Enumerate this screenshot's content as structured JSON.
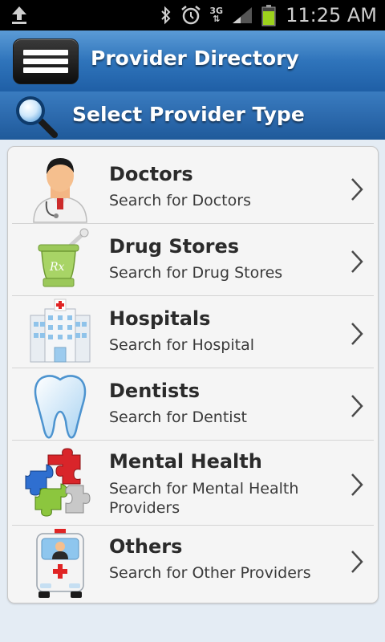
{
  "status_bar": {
    "time": "11:25 AM",
    "network": "3G",
    "icons": [
      "upload-icon",
      "bluetooth-icon",
      "alarm-icon",
      "network-3g-icon",
      "signal-icon",
      "battery-icon"
    ]
  },
  "header": {
    "title": "Provider Directory",
    "menu_icon": "hamburger-menu-icon"
  },
  "section": {
    "title": "Select Provider Type",
    "icon": "magnifier-icon"
  },
  "providers": [
    {
      "title": "Doctors",
      "subtitle": "Search for Doctors",
      "icon": "doctor-icon"
    },
    {
      "title": "Drug Stores",
      "subtitle": "Search for Drug Stores",
      "icon": "pharmacy-mortar-icon"
    },
    {
      "title": "Hospitals",
      "subtitle": "Search for Hospital",
      "icon": "hospital-building-icon"
    },
    {
      "title": "Dentists",
      "subtitle": "Search for Dentist",
      "icon": "tooth-icon"
    },
    {
      "title": "Mental Health",
      "subtitle": "Search for Mental Health Providers",
      "icon": "puzzle-icon"
    },
    {
      "title": "Others",
      "subtitle": "Search for Other Providers",
      "icon": "ambulance-icon"
    }
  ],
  "colors": {
    "header_blue": "#2f74bb",
    "section_blue": "#2a67aa",
    "list_background": "#f5f5f5",
    "page_background": "#e4ecf4"
  }
}
